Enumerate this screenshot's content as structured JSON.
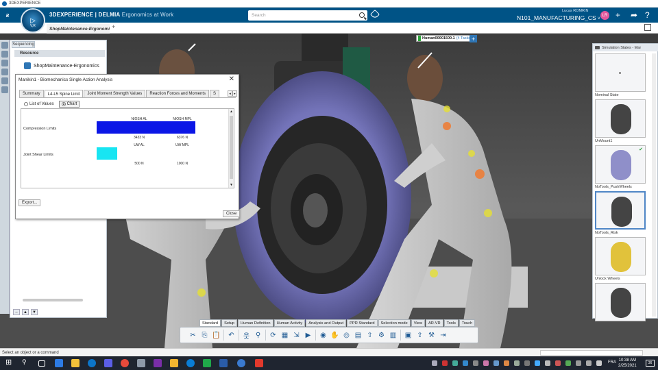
{
  "window": {
    "title": "3DEXPERIENCE"
  },
  "header": {
    "brand_prefix": "3D",
    "brand_main": "EXPERIENCE | DELMIA",
    "app_name": "Ergonomics at Work",
    "search_placeholder": "Search",
    "user_name": "Lucas ROMRIN",
    "avatar_initials": "LR",
    "collab_space": "N101_MANUFACTURING_CS",
    "compass_label": "V,R"
  },
  "tabs": {
    "active_doc": "ShopMaintenance-Ergonomic",
    "new_tab": "+"
  },
  "tree": {
    "tab_label": "Sequencing",
    "resource_label": "Resource",
    "root_item": "ShopMaintenance-Ergonomics",
    "footer_up": "▲",
    "footer_down": "▼"
  },
  "viewport": {
    "human_label": "Human00001500.1",
    "human_tasks": "(4 Tasks)",
    "human_add": "+"
  },
  "dialog": {
    "title": "Manikin1 - Biomechanics Single Action Analysis",
    "close_glyph": "✕",
    "tabs": [
      "Summary",
      "L4-L5 Spine Limit",
      "Joint Moment Strength Values",
      "Reaction Forces and Moments",
      "S"
    ],
    "active_tab": 1,
    "radio_list": "List of Values",
    "radio_chart": "Chart",
    "selected_view": "Chart",
    "export_label": "Export...",
    "close_label": "Close"
  },
  "chart_data": {
    "type": "bar",
    "orientation": "horizontal",
    "categories": [
      "Compression Limits",
      "Joint Shear Limits"
    ],
    "threshold_labels": [
      [
        "NIOSH AL",
        "NIOSH MPL"
      ],
      [
        "UW AL",
        "UW MPL"
      ]
    ],
    "threshold_values": [
      [
        "3433 N",
        "6376 N"
      ],
      [
        "500 N",
        "1000 N"
      ]
    ],
    "thresholds_numeric": [
      [
        3433,
        6376
      ],
      [
        500,
        1000
      ]
    ],
    "bar_values": [
      6376,
      500
    ],
    "bar_colors": [
      "#0b16e6",
      "#18e5f2"
    ],
    "legend": "none",
    "grid": false
  },
  "sim_panel": {
    "title": "Simulation States - Mar",
    "states": [
      {
        "name": "Nominal State",
        "checked": false,
        "selected": false
      },
      {
        "name": "UnMount1",
        "checked": false,
        "selected": false
      },
      {
        "name": "NoTools_PushWheels",
        "checked": true,
        "selected": false
      },
      {
        "name": "NoTools_Risk",
        "checked": false,
        "selected": true
      },
      {
        "name": "Unlock Wheels",
        "checked": false,
        "selected": false
      },
      {
        "name": "",
        "checked": false,
        "selected": false
      }
    ],
    "check_glyph": "✔"
  },
  "action_bar": {
    "tabs": [
      "Standard",
      "Setup",
      "Human Definition",
      "Human Activity",
      "Analysis and Output",
      "PPR Standard",
      "Selection mode",
      "View",
      "AR-VR",
      "Tools",
      "Touch"
    ],
    "active_tab": 0
  },
  "status": {
    "prompt": "Select an object or a command"
  },
  "taskbar": {
    "lang": "FRA",
    "time": "10:38 AM",
    "date": "2/25/2021",
    "notif_count": "36"
  }
}
